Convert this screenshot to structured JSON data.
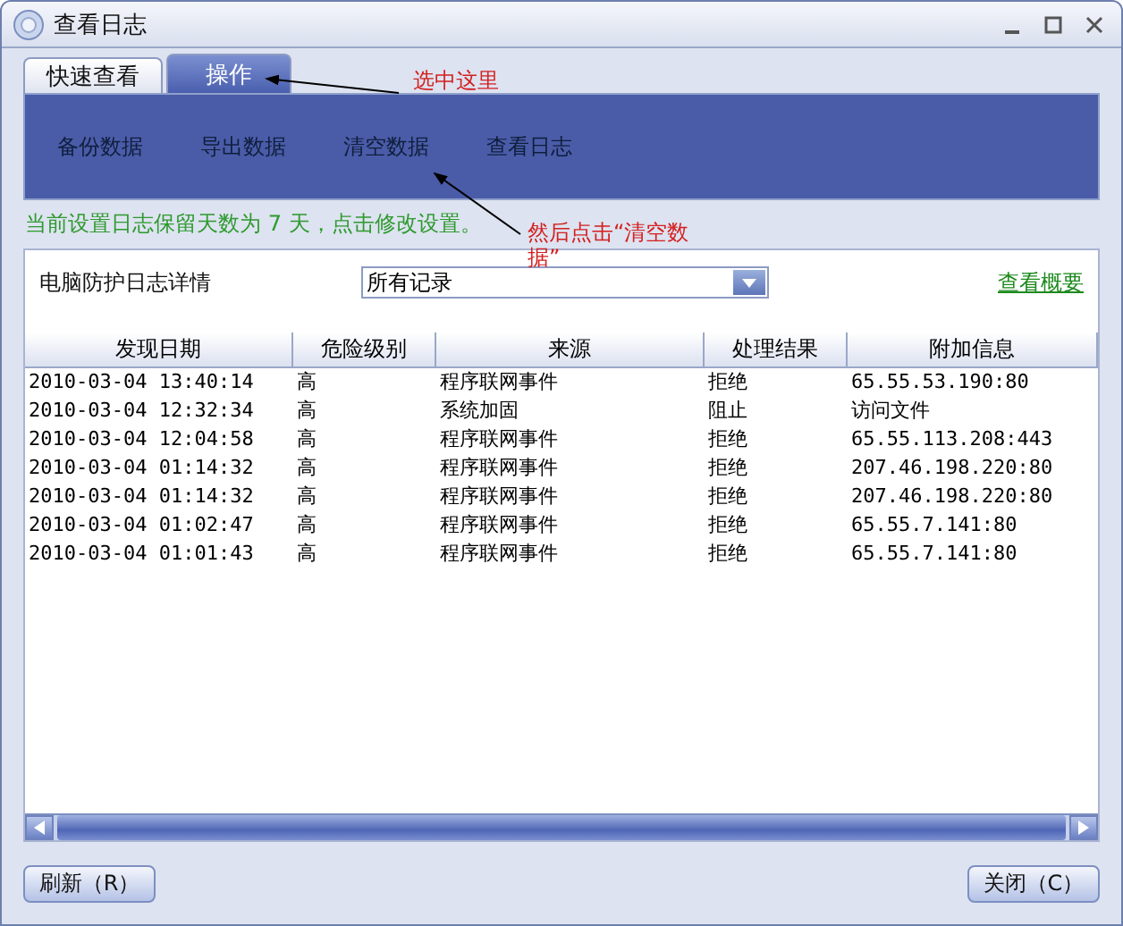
{
  "window": {
    "title": "查看日志"
  },
  "tabs": [
    {
      "label": "快速查看",
      "selected": false
    },
    {
      "label": "操作",
      "selected": true
    }
  ],
  "actions": [
    "备份数据",
    "导出数据",
    "清空数据",
    "查看日志"
  ],
  "retention_note": "当前设置日志保留天数为 7 天，点击修改设置。",
  "panel": {
    "title": "电脑防护日志详情",
    "filter": {
      "value": "所有记录"
    },
    "summary_link": "查看概要"
  },
  "table": {
    "columns": [
      "发现日期",
      "危险级别",
      "来源",
      "处理结果",
      "附加信息"
    ],
    "rows": [
      [
        "2010-03-04 13:40:14",
        "高",
        "程序联网事件",
        "拒绝",
        "65.55.53.190:80"
      ],
      [
        "2010-03-04 12:32:34",
        "高",
        "系统加固",
        "阻止",
        "访问文件"
      ],
      [
        "2010-03-04 12:04:58",
        "高",
        "程序联网事件",
        "拒绝",
        "65.55.113.208:443"
      ],
      [
        "2010-03-04 01:14:32",
        "高",
        "程序联网事件",
        "拒绝",
        "207.46.198.220:80"
      ],
      [
        "2010-03-04 01:14:32",
        "高",
        "程序联网事件",
        "拒绝",
        "207.46.198.220:80"
      ],
      [
        "2010-03-04 01:02:47",
        "高",
        "程序联网事件",
        "拒绝",
        "65.55.7.141:80"
      ],
      [
        "2010-03-04 01:01:43",
        "高",
        "程序联网事件",
        "拒绝",
        "65.55.7.141:80"
      ]
    ]
  },
  "buttons": [
    {
      "label": "刷新（R）"
    },
    {
      "label": "关闭（C）"
    }
  ],
  "annotations": [
    "选中这里",
    "然后点击“清空数据”"
  ]
}
